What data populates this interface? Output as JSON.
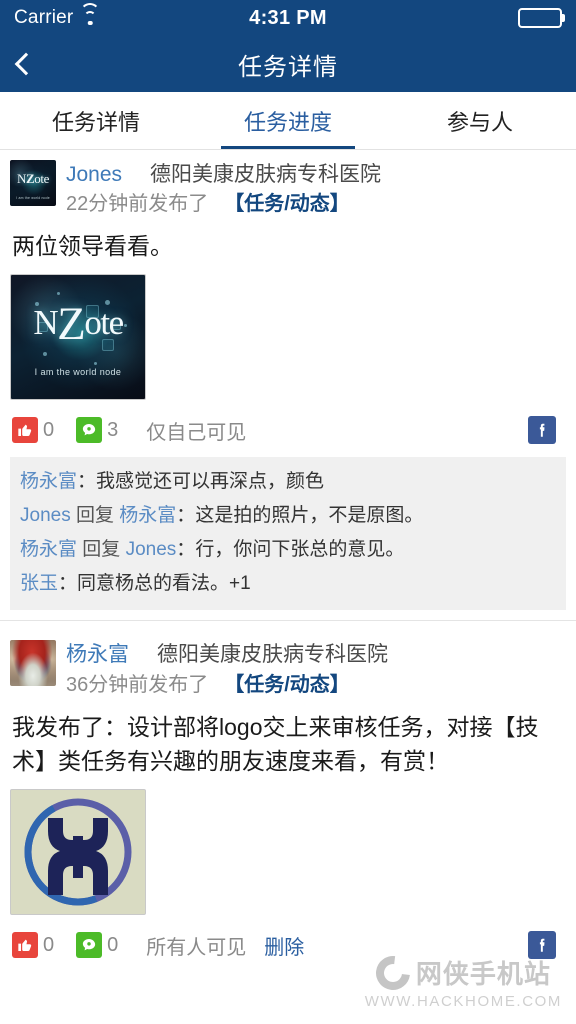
{
  "status_bar": {
    "carrier": "Carrier",
    "wifi_icon": "wifi-icon",
    "time": "4:31 PM",
    "battery_icon": "battery-full-icon"
  },
  "nav": {
    "back_icon": "chevron-left-icon",
    "title": "任务详情"
  },
  "tabs": [
    {
      "label": "任务详情",
      "active": false
    },
    {
      "label": "任务进度",
      "active": true
    },
    {
      "label": "参与人",
      "active": false
    }
  ],
  "colors": {
    "nav_background": "#13477f",
    "tab_active": "#2a5ea0",
    "author_link": "#3f7ab8",
    "tag": "#13477f",
    "like": "#e8453c",
    "comment": "#4cbb28",
    "facebook": "#3b5998",
    "comments_background": "#f0f0f0"
  },
  "posts": [
    {
      "avatar_name": "avatar-jones-nzote",
      "author": "Jones",
      "org": "德阳美康皮肤病专科医院",
      "time": "22分钟前发布了",
      "tag": "【任务/动态】",
      "body": "两位领导看看。",
      "images": [
        {
          "name": "post-image-nzote",
          "word_n": "N",
          "word_z": "Z",
          "word_rest": "ote",
          "tagline": "I am the world node"
        }
      ],
      "actions": {
        "like_icon": "thumbs-up-icon",
        "like_count": "0",
        "comment_icon": "comment-bubble-icon",
        "comment_count": "3",
        "visibility": "仅自己可见",
        "delete_label": "",
        "share_icon": "facebook-icon"
      },
      "comments": [
        {
          "user": "杨永富",
          "reply_label": "",
          "target": "",
          "sep": "：",
          "text": "我感觉还可以再深点，颜色"
        },
        {
          "user": "Jones",
          "reply_label": "回复",
          "target": "杨永富",
          "sep": "：",
          "text": "这是拍的照片，不是原图。"
        },
        {
          "user": "杨永富",
          "reply_label": "回复",
          "target": "Jones",
          "sep": "：",
          "text": "行，你问下张总的意见。"
        },
        {
          "user": "张玉",
          "reply_label": "",
          "target": "",
          "sep": "：",
          "text": "同意杨总的看法。+1"
        }
      ]
    },
    {
      "avatar_name": "avatar-yangyongfu-photo",
      "author": "杨永富",
      "org": "德阳美康皮肤病专科医院",
      "time": "36分钟前发布了",
      "tag": "【任务/动态】",
      "body": "我发布了：设计部将logo交上来审核任务，对接【技术】类任务有兴趣的朋友速度来看，有赏！",
      "images": [
        {
          "name": "post-image-hh-logo",
          "word_n": "",
          "word_z": "",
          "word_rest": "",
          "tagline": ""
        }
      ],
      "actions": {
        "like_icon": "thumbs-up-icon",
        "like_count": "0",
        "comment_icon": "comment-bubble-icon",
        "comment_count": "0",
        "visibility": "所有人可见",
        "delete_label": "删除",
        "share_icon": "facebook-icon"
      },
      "comments": []
    }
  ],
  "watermark": {
    "site_name": "网侠手机站",
    "url": "WWW.HACKHOME.COM",
    "logo_icon": "hackhome-ring-icon"
  }
}
